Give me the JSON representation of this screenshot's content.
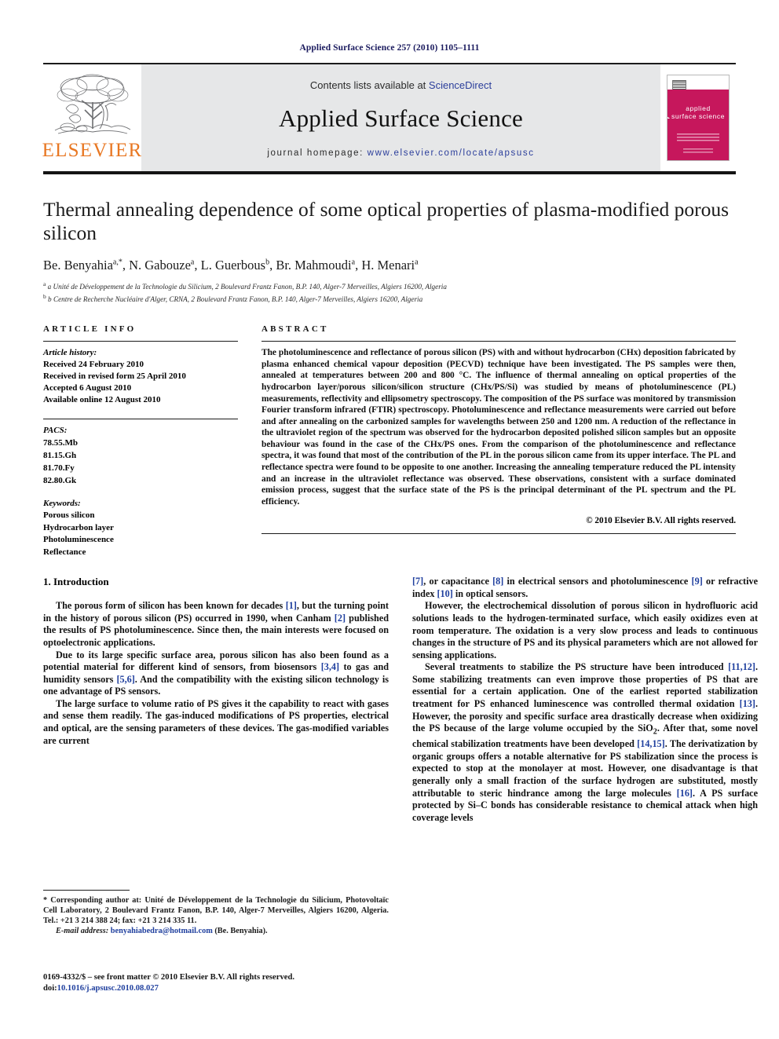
{
  "running_head": "Applied Surface Science 257 (2010) 1105–1111",
  "masthead": {
    "publisher_name": "ELSEVIER",
    "contents_prefix": "Contents lists available at ",
    "contents_link": "ScienceDirect",
    "journal_title": "Applied Surface Science",
    "homepage_prefix": "journal homepage:",
    "homepage_url": "www.elsevier.com/locate/apsusc",
    "cover_title_line1": "applied",
    "cover_title_line2": "surface science",
    "cover_color": "#C6175C",
    "link_color": "#2b3e9b",
    "brand_color": "#E87722"
  },
  "article": {
    "title": "Thermal annealing dependence of some optical properties of plasma-modified porous silicon",
    "authors": "Be. Benyahia a,*, N. Gabouze a, L. Guerbous b, Br. Mahmoudi a, H. Menari a",
    "affiliation_a": "a Unité de Développement de la Technologie du Silicium, 2 Boulevard Frantz Fanon, B.P. 140, Alger-7 Merveilles, Algiers 16200, Algeria",
    "affiliation_b": "b Centre de Recherche Nucléaire d'Alger, CRNA, 2 Boulevard Frantz Fanon, B.P. 140, Alger-7 Merveilles, Algiers 16200, Algeria"
  },
  "article_info": {
    "heading": "ARTICLE INFO",
    "history_title": "Article history:",
    "history": [
      "Received 24 February 2010",
      "Received in revised form 25 April 2010",
      "Accepted 6 August 2010",
      "Available online 12 August 2010"
    ],
    "pacs_title": "PACS:",
    "pacs": [
      "78.55.Mb",
      "81.15.Gh",
      "81.70.Fy",
      "82.80.Gk"
    ],
    "keywords_title": "Keywords:",
    "keywords": [
      "Porous silicon",
      "Hydrocarbon layer",
      "Photoluminescence",
      "Reflectance"
    ]
  },
  "abstract": {
    "heading": "ABSTRACT",
    "text": "The photoluminescence and reflectance of porous silicon (PS) with and without hydrocarbon (CHx) deposition fabricated by plasma enhanced chemical vapour deposition (PECVD) technique have been investigated. The PS samples were then, annealed at temperatures between 200 and 800 °C. The influence of thermal annealing on optical properties of the hydrocarbon layer/porous silicon/silicon structure (CHx/PS/Si) was studied by means of photoluminescence (PL) measurements, reflectivity and ellipsometry spectroscopy. The composition of the PS surface was monitored by transmission Fourier transform infrared (FTIR) spectroscopy. Photoluminescence and reflectance measurements were carried out before and after annealing on the carbonized samples for wavelengths between 250 and 1200 nm. A reduction of the reflectance in the ultraviolet region of the spectrum was observed for the hydrocarbon deposited polished silicon samples but an opposite behaviour was found in the case of the CHx/PS ones. From the comparison of the photoluminescence and reflectance spectra, it was found that most of the contribution of the PL in the porous silicon came from its upper interface. The PL and reflectance spectra were found to be opposite to one another. Increasing the annealing temperature reduced the PL intensity and an increase in the ultraviolet reflectance was observed. These observations, consistent with a surface dominated emission process, suggest that the surface state of the PS is the principal determinant of the PL spectrum and the PL efficiency.",
    "copyright": "© 2010 Elsevier B.V. All rights reserved."
  },
  "introduction": {
    "heading": "1.  Introduction",
    "left_paragraphs": [
      "The porous form of silicon has been known for decades [1], but the turning point in the history of porous silicon (PS) occurred in 1990, when Canham [2] published the results of PS photoluminescence. Since then, the main interests were focused on optoelectronic applications.",
      "Due to its large specific surface area, porous silicon has also been found as a potential material for different kind of sensors, from biosensors [3,4] to gas and humidity sensors [5,6]. And the compatibility with the existing silicon technology is one advantage of PS sensors.",
      "The large surface to volume ratio of PS gives it the capability to react with gases and sense them readily. The gas-induced modifications of PS properties, electrical and optical, are the sensing parameters of these devices. The gas-modified variables are current"
    ],
    "right_paragraphs": [
      "[7], or capacitance [8] in electrical sensors and photoluminescence [9] or refractive index [10] in optical sensors.",
      "However, the electrochemical dissolution of porous silicon in hydrofluoric acid solutions leads to the hydrogen-terminated surface, which easily oxidizes even at room temperature. The oxidation is a very slow process and leads to continuous changes in the structure of PS and its physical parameters which are not allowed for sensing applications.",
      "Several treatments to stabilize the PS structure have been introduced [11,12]. Some stabilizing treatments can even improve those properties of PS that are essential for a certain application. One of the earliest reported stabilization treatment for PS enhanced luminescence was controlled thermal oxidation [13]. However, the porosity and specific surface area drastically decrease when oxidizing the PS because of the large volume occupied by the SiO2. After that, some novel chemical stabilization treatments have been developed [14,15]. The derivatization by organic groups offers a notable alternative for PS stabilization since the process is expected to stop at the monolayer at most. However, one disadvantage is that generally only a small fraction of the surface hydrogen are substituted, mostly attributable to steric hindrance among the large molecules [16]. A PS surface protected by Si–C bonds has considerable resistance to chemical attack when high coverage levels"
    ]
  },
  "footnotes": {
    "corresponding": "* Corresponding author at: Unité de Développement de la Technologie du Silicium, Photovoltaïc Cell Laboratory, 2 Boulevard Frantz Fanon, B.P. 140, Alger-7 Merveilles, Algiers 16200, Algeria. Tel.: +21 3 214 388 24; fax: +21 3 214 335 11.",
    "email_label": "E-mail address:",
    "email": "benyahiabedra@hotmail.com",
    "email_owner": "(Be. Benyahia).",
    "front_matter": "0169-4332/$ – see front matter © 2010 Elsevier B.V. All rights reserved.",
    "doi_label": "doi:",
    "doi": "10.1016/j.apsusc.2010.08.027"
  }
}
